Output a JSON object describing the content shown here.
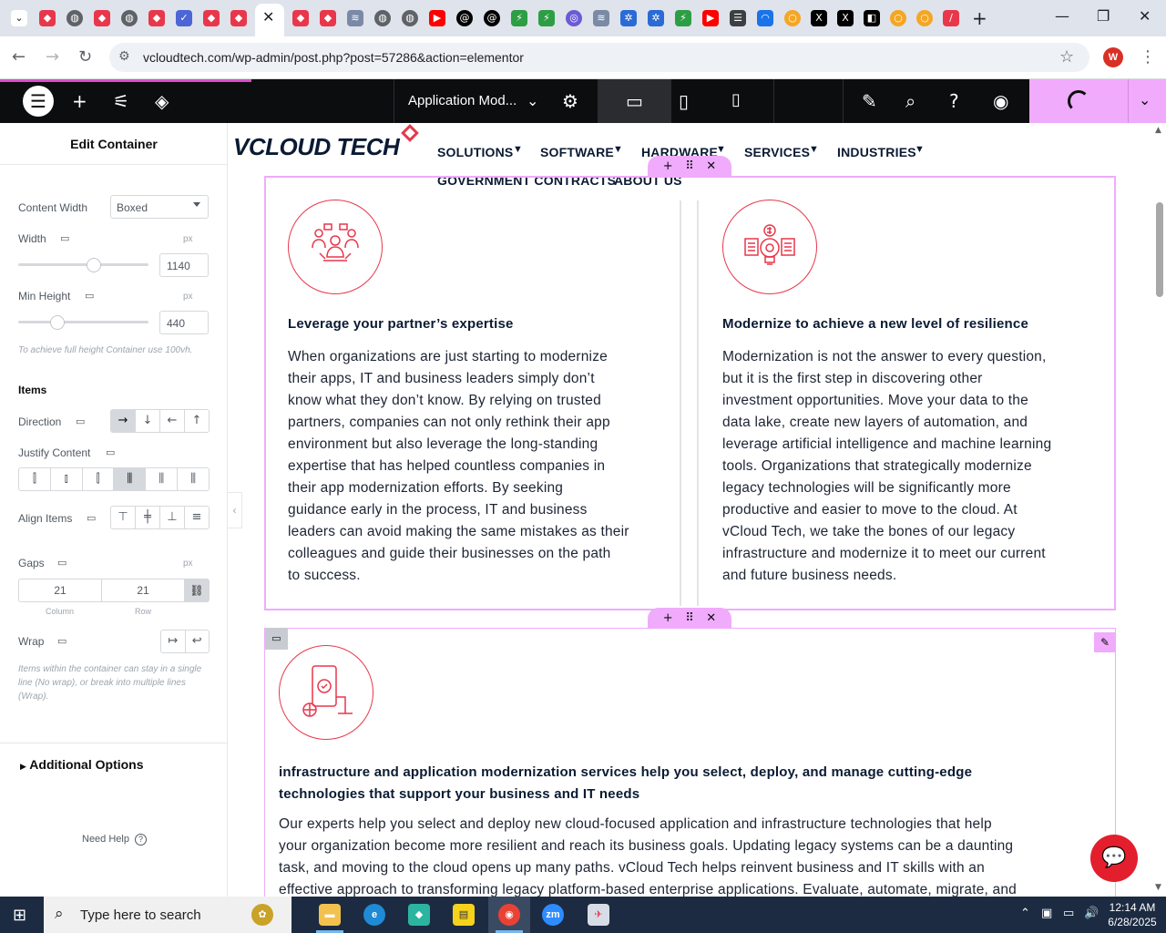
{
  "browser": {
    "url": "vcloudtech.com/wp-admin/post.php?post=57286&action=elementor",
    "profile_initial": "W",
    "tab_close": "✕",
    "new_tab": "+"
  },
  "elementor": {
    "page_title": "Application Mod...",
    "panel_title": "Edit Container",
    "content_width_label": "Content Width",
    "content_width_value": "Boxed",
    "width_label": "Width",
    "width_unit": "px",
    "width_value": "1140",
    "width_level": 0.58,
    "min_height_label": "Min Height",
    "min_height_unit": "px",
    "min_height_value": "440",
    "min_height_level": 0.3,
    "min_height_hint": "To achieve full height Container use 100vh.",
    "items_heading": "Items",
    "direction_label": "Direction",
    "justify_label": "Justify Content",
    "align_label": "Align Items",
    "gaps_label": "Gaps",
    "gaps_unit": "px",
    "gap_column": "21",
    "gap_row": "21",
    "gap_column_label": "Column",
    "gap_row_label": "Row",
    "wrap_label": "Wrap",
    "wrap_hint": "Items within the container can stay in a single line (No wrap), or break into multiple lines (Wrap).",
    "additional_options": "Additional Options",
    "need_help": "Need Help"
  },
  "site": {
    "logo": "VCLOUD TECH",
    "menu": [
      "SOLUTIONS",
      "SOFTWARE",
      "HARDWARE",
      "SERVICES",
      "INDUSTRIES",
      "GOVERNMENT CONTRACTS",
      "ABOUT US"
    ],
    "col1_heading": "Leverage your partner’s expertise",
    "col1_lines": [
      "When organizations are just starting to modernize",
      "their apps, IT and business leaders simply don’t",
      "know what they don’t know. By relying on trusted",
      "partners, companies can not only rethink their app",
      "environment but also leverage the long-standing",
      "expertise that has helped countless companies in",
      "their app modernization efforts. By seeking",
      "guidance early in the process, IT and business",
      "leaders can avoid making the same mistakes as their",
      "colleagues and guide their businesses on the path",
      "to success."
    ],
    "col2_heading": "Modernize to achieve a new level of resilience",
    "col2_lines": [
      "Modernization is not the answer to every question,",
      "but it is the first step in discovering other",
      "investment opportunities. Move your data to the",
      "data lake, create new layers of automation, and",
      "leverage artificial intelligence and machine learning",
      "tools. Organizations that strategically modernize",
      "legacy technologies will be significantly more",
      "productive and easier to move to the cloud. At",
      "vCloud Tech, we take the bones of our legacy",
      "infrastructure and modernize it to meet our current",
      "and future business needs."
    ],
    "sec2_heading_lines": [
      "infrastructure and application modernization services help you select, deploy, and manage cutting-edge",
      "technologies that support your business and IT needs"
    ],
    "sec2_lines": [
      "Our experts help you select and deploy new cloud-focused application and infrastructure technologies that help",
      "your organization become more resilient and reach its business goals. Updating legacy systems can be a daunting",
      "task, and moving to the cloud opens up many paths. vCloud Tech helps reinvent business and IT skills with an",
      "effective approach to transforming legacy platform-based enterprise applications. Evaluate, automate, migrate, and"
    ]
  },
  "taskbar": {
    "search_placeholder": "Type here to search",
    "time": "12:14 AM",
    "date": "6/28/2025"
  },
  "colors": {
    "accent_pink": "#f0abfc",
    "brand_red": "#e8374b",
    "elementor_dark": "#0c0d0e"
  }
}
